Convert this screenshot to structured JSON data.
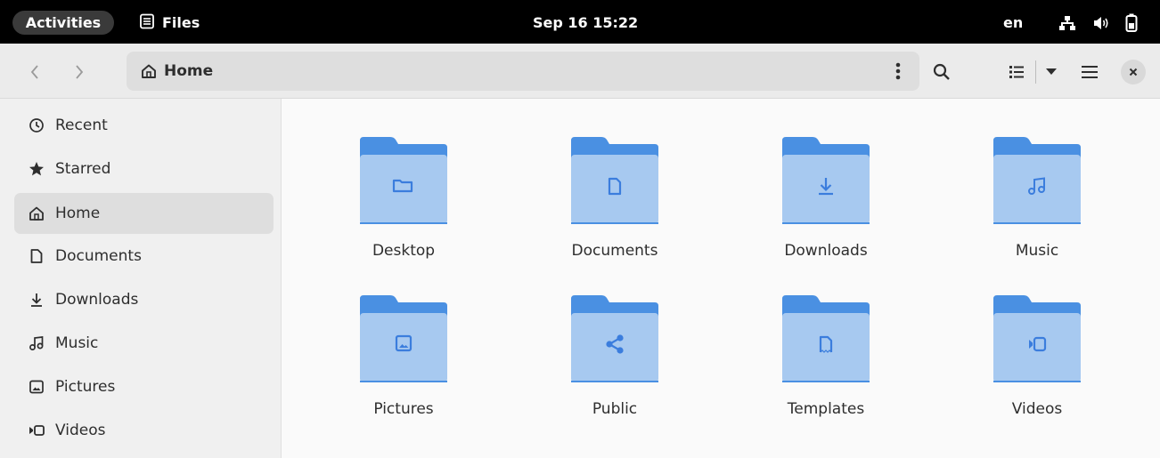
{
  "topbar": {
    "activities": "Activities",
    "app_name": "Files",
    "clock": "Sep 16  15:22",
    "lang": "en"
  },
  "headerbar": {
    "path": "Home"
  },
  "sidebar": {
    "items": [
      {
        "label": "Recent",
        "icon": "clock-icon"
      },
      {
        "label": "Starred",
        "icon": "star-icon"
      },
      {
        "label": "Home",
        "icon": "home-icon",
        "active": true
      },
      {
        "label": "Documents",
        "icon": "document-icon"
      },
      {
        "label": "Downloads",
        "icon": "download-icon"
      },
      {
        "label": "Music",
        "icon": "music-icon"
      },
      {
        "label": "Pictures",
        "icon": "picture-icon"
      },
      {
        "label": "Videos",
        "icon": "video-icon"
      }
    ]
  },
  "folders": [
    {
      "label": "Desktop",
      "emblem": "folder-emblem-icon"
    },
    {
      "label": "Documents",
      "emblem": "document-emblem-icon"
    },
    {
      "label": "Downloads",
      "emblem": "download-emblem-icon"
    },
    {
      "label": "Music",
      "emblem": "music-emblem-icon"
    },
    {
      "label": "Pictures",
      "emblem": "picture-emblem-icon"
    },
    {
      "label": "Public",
      "emblem": "share-emblem-icon"
    },
    {
      "label": "Templates",
      "emblem": "template-emblem-icon"
    },
    {
      "label": "Videos",
      "emblem": "video-emblem-icon"
    }
  ],
  "colors": {
    "folder_back": "#4a90e2",
    "folder_front": "#a7c9f0",
    "folder_emblem": "#3b7ddd",
    "active_bg": "#dedede"
  }
}
